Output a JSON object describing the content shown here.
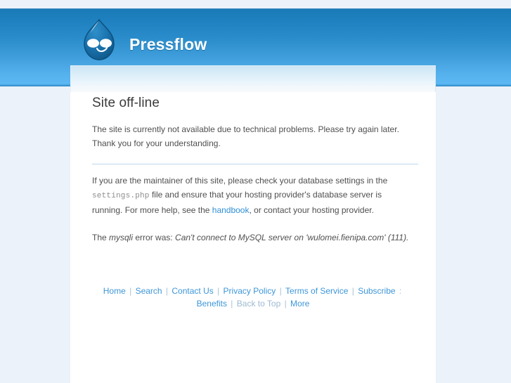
{
  "header": {
    "site_name": "Pressflow",
    "logo_icon": "drupal-droplet-icon"
  },
  "main": {
    "title": "Site off-line",
    "intro": "The site is currently not available due to technical problems. Please try again later. Thank you for your understanding.",
    "maintainer": {
      "part1": "If you are the maintainer of this site, please check your database settings in the ",
      "code": "settings.php",
      "part2": " file and ensure that your hosting provider's database server is running. For more help, see the ",
      "handbook_link": "handbook",
      "part3": ", or contact your hosting provider."
    },
    "error": {
      "prefix": "The ",
      "driver": "mysqli",
      "middle": " error was: ",
      "message": "Can't connect to MySQL server on 'wulomei.fienipa.com' (111)."
    }
  },
  "footer": {
    "separator": "|",
    "colon": ":",
    "links": [
      {
        "label": "Home",
        "muted": false
      },
      {
        "label": "Search",
        "muted": false
      },
      {
        "label": "Contact Us",
        "muted": false
      },
      {
        "label": "Privacy Policy",
        "muted": false
      },
      {
        "label": "Terms of Service",
        "muted": false
      },
      {
        "label": "Subscribe",
        "muted": false
      },
      {
        "label": "Benefits",
        "muted": false
      },
      {
        "label": "Back to Top",
        "muted": true
      },
      {
        "label": "More",
        "muted": false
      }
    ]
  },
  "colors": {
    "header_top": "#1a7ab8",
    "header_bottom": "#5bb8f3",
    "page_background": "#ebf2f9",
    "link": "#2e8fd6",
    "muted_link": "#9dbad2",
    "divider": "#b9d7ea",
    "body_text": "#4f4f4f"
  }
}
